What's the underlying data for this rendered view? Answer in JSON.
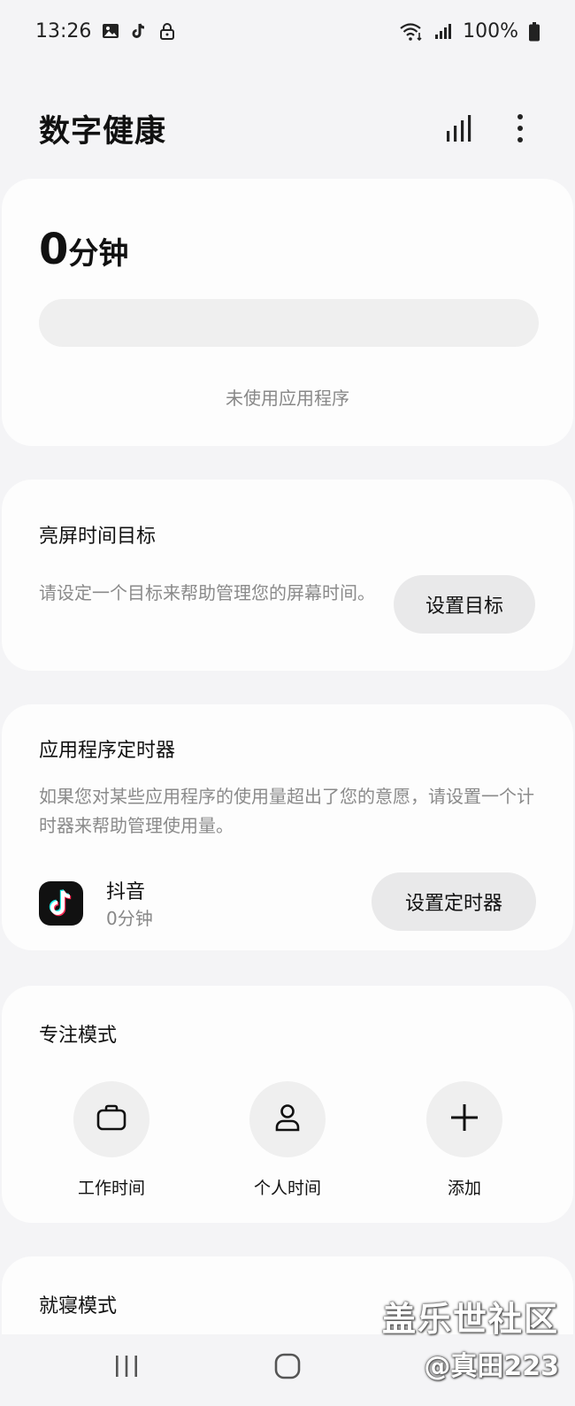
{
  "status_bar": {
    "time": "13:26",
    "battery": "100%",
    "left_icons": [
      "image-icon",
      "tiktok-notification-icon",
      "lock-icon"
    ],
    "right_icons": [
      "wifi-icon",
      "signal-icon",
      "battery-icon"
    ]
  },
  "header": {
    "title": "数字健康",
    "actions": [
      "bar-chart-icon",
      "more-vert-icon"
    ]
  },
  "usage": {
    "total_value": "0",
    "total_unit": "分钟",
    "progress": 0,
    "empty_text": "未使用应用程序"
  },
  "screen_time_goal": {
    "title": "亮屏时间目标",
    "description": "请设定一个目标来帮助管理您的屏幕时间。",
    "button_label": "设置目标"
  },
  "app_timer": {
    "title": "应用程序定时器",
    "description": "如果您对某些应用程序的使用量超出了您的意愿，请设置一个计时器来帮助管理使用量。",
    "app_name": "抖音",
    "app_usage": "0分钟",
    "button_label": "设置定时器"
  },
  "focus_mode": {
    "title": "专注模式",
    "items": [
      {
        "label": "工作时间",
        "icon": "briefcase-icon"
      },
      {
        "label": "个人时间",
        "icon": "person-icon"
      },
      {
        "label": "添加",
        "icon": "plus-icon"
      }
    ]
  },
  "bedtime_mode": {
    "title": "就寝模式"
  },
  "nav": {
    "buttons": [
      "recents-icon",
      "home-icon"
    ]
  },
  "watermark": {
    "line1": "盖乐世社区",
    "line2": "@真田223"
  },
  "colors": {
    "background": "#f4f4f6",
    "card": "#fdfdfd",
    "pill": "#e9e9ea",
    "muted_text": "#8a8a8a"
  }
}
